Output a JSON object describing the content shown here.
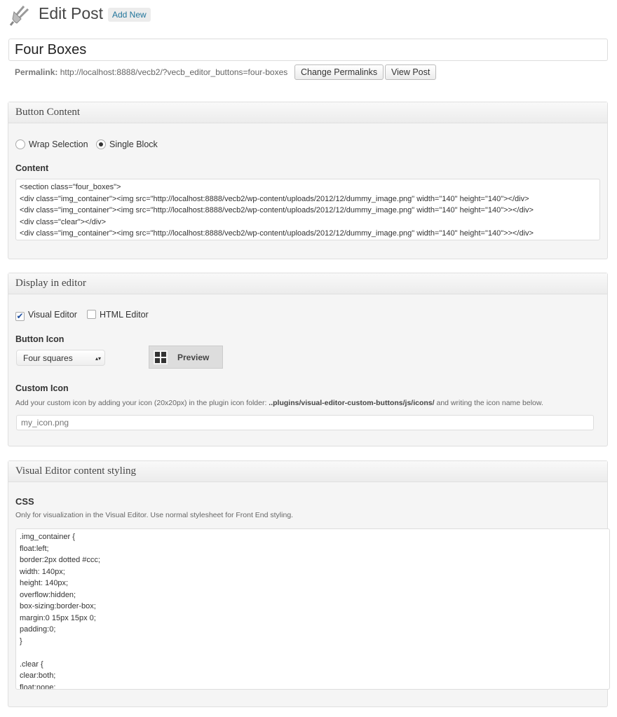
{
  "header": {
    "title": "Edit Post",
    "add_new": "Add New",
    "icon": "plugin-plug-icon"
  },
  "post": {
    "title": "Four Boxes",
    "permalink_label": "Permalink:",
    "permalink_url": "http://localhost:8888/vecb2/?vecb_editor_buttons=four-boxes",
    "change_permalinks": "Change Permalinks",
    "view_post": "View Post"
  },
  "button_content": {
    "heading": "Button Content",
    "radio_wrap": "Wrap Selection",
    "radio_single": "Single Block",
    "selected": "Single Block",
    "content_label": "Content",
    "content": "<section class=\"four_boxes\">\n<div class=\"img_container\"><img src=\"http://localhost:8888/vecb2/wp-content/uploads/2012/12/dummy_image.png\" width=\"140\" height=\"140\"></div>\n<div class=\"img_container\"><img src=\"http://localhost:8888/vecb2/wp-content/uploads/2012/12/dummy_image.png\" width=\"140\" height=\"140\">></div>\n<div class=\"clear\"></div>\n<div class=\"img_container\"><img src=\"http://localhost:8888/vecb2/wp-content/uploads/2012/12/dummy_image.png\" width=\"140\" height=\"140\">></div>"
  },
  "display": {
    "heading": "Display in editor",
    "visual_editor": "Visual Editor",
    "visual_checked": true,
    "html_editor": "HTML Editor",
    "html_checked": false,
    "button_icon_label": "Button Icon",
    "icon_select": "Four squares",
    "preview": "Preview",
    "custom_icon_label": "Custom Icon",
    "custom_desc_pre": "Add your custom icon by adding your icon (20x20px) in the plugin icon folder: ",
    "custom_desc_path": "..plugins/visual-editor-custom-buttons/js/icons/",
    "custom_desc_post": " and writing the icon name below.",
    "custom_placeholder": "my_icon.png"
  },
  "styling": {
    "heading": "Visual Editor content styling",
    "css_label": "CSS",
    "css_desc": "Only for visualization in the Visual Editor. Use normal stylesheet for Front End styling.",
    "css": ".img_container {\nfloat:left;\nborder:2px dotted #ccc;\nwidth: 140px;\nheight: 140px;\noverflow:hidden;\nbox-sizing:border-box;\nmargin:0 15px 15px 0;\npadding:0;\n}\n\n.clear {\nclear:both;\nfloat:none;"
  }
}
